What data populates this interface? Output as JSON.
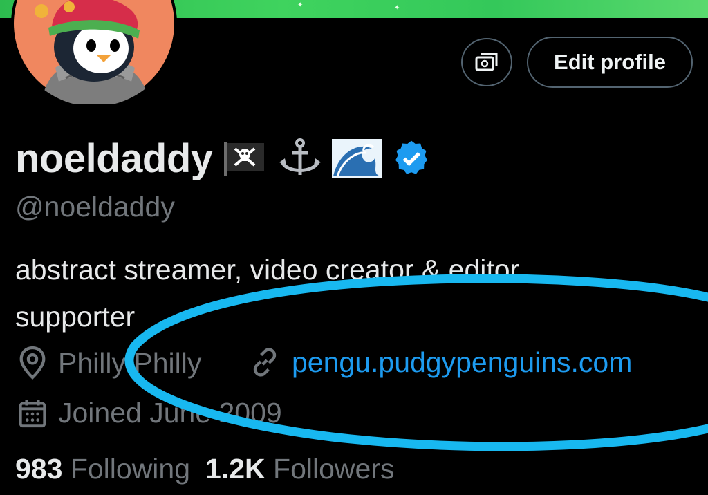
{
  "profile": {
    "display_name": "noeldaddy",
    "name_emojis": [
      "pirate-flag",
      "anchor",
      "wave"
    ],
    "verified": true,
    "handle": "@noeldaddy",
    "bio_line1": "abstract streamer, video creator & editor,",
    "bio_line2": "supporter",
    "location": "Philly Philly",
    "website": "pengu.pudgypenguins.com",
    "joined": "Joined June 2009"
  },
  "actions": {
    "edit_profile_label": "Edit profile",
    "monetize_icon": "money-icon"
  },
  "stats": {
    "following_count": "983",
    "following_label": "Following",
    "followers_count": "1.2K",
    "followers_label": "Followers"
  },
  "colors": {
    "accent": "#1d9bf0",
    "muted": "#71767b",
    "annotation": "#18b8f0",
    "banner": "#34c85a"
  }
}
